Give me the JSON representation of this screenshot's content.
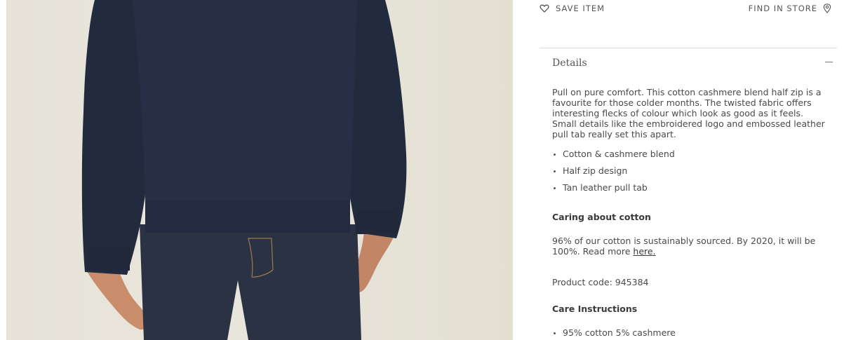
{
  "actions": {
    "save_label": "SAVE ITEM",
    "store_label": "FIND IN STORE"
  },
  "details": {
    "title": "Details",
    "description": "Pull on pure comfort. This cotton cashmere blend half zip is a favourite for those colder months. The twisted fabric offers interesting flecks of colour which look as good as it feels. Small details like the embroidered logo and embossed leather pull tab really set this apart.",
    "features": [
      "Cotton & cashmere blend",
      "Half zip design",
      "Tan leather pull tab"
    ],
    "cotton_heading": "Caring about cotton",
    "cotton_text": "96% of our cotton is sustainably sourced. By 2020, it will be 100%. Read more ",
    "cotton_link": "here.",
    "product_code": "Product code: 945384",
    "care_heading": "Care Instructions",
    "care_items": [
      "95% cotton 5% cashmere"
    ]
  },
  "colors": {
    "sweater": "#262f45",
    "jeans": "#2b3244",
    "skin": "#c98d6c",
    "background": "#e6e2d7"
  },
  "icons": {
    "save": "heart-icon",
    "store": "location-pin-icon",
    "collapse": "minus-icon"
  }
}
